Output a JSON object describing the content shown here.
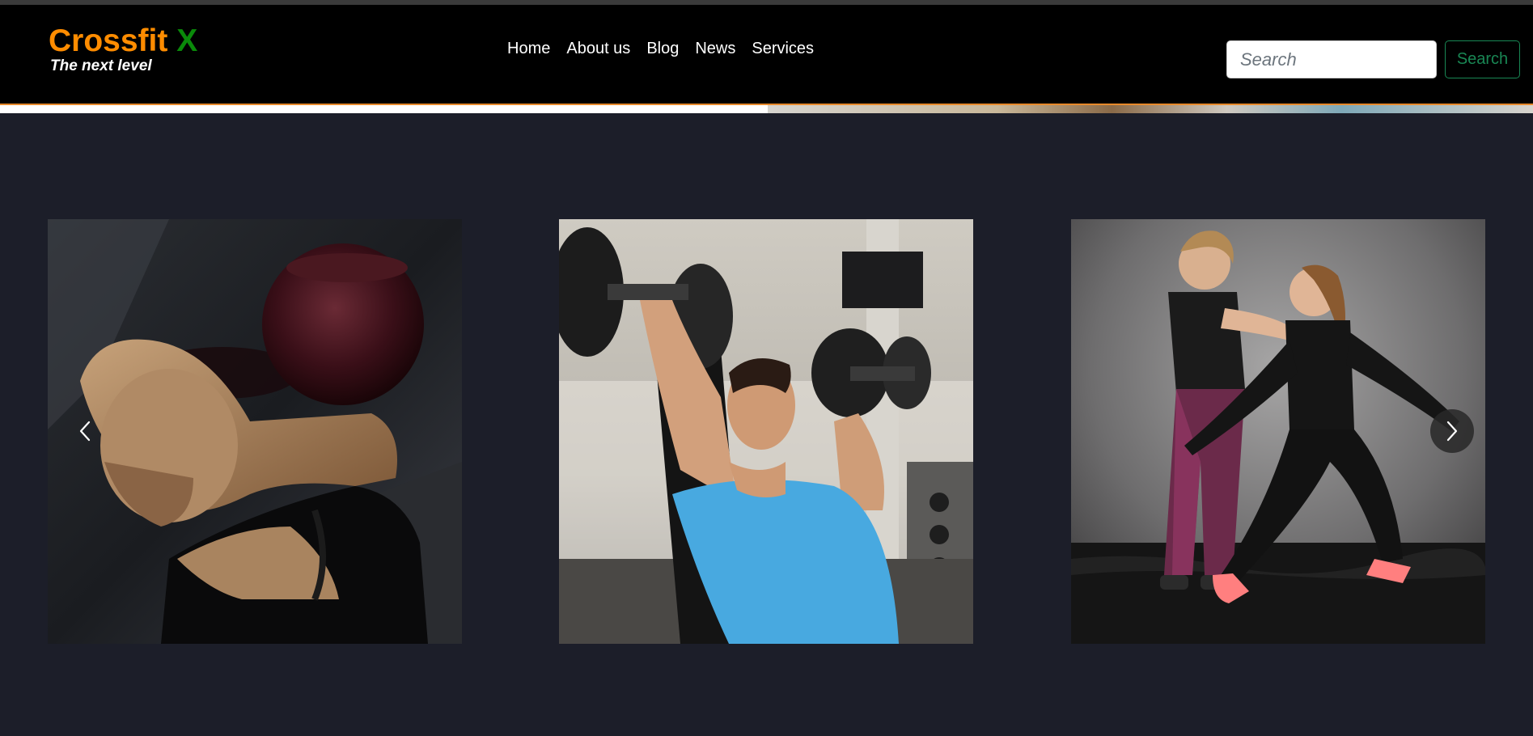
{
  "brand": {
    "name": "Crossfit",
    "accent": "X",
    "tagline": "The next level"
  },
  "nav": {
    "items": [
      "Home",
      "About us",
      "Blog",
      "News",
      "Services"
    ]
  },
  "search": {
    "placeholder": "Search",
    "button_label": "Search"
  },
  "colors": {
    "brand_orange": "#ff8c00",
    "brand_green": "#0a8a0a",
    "search_button": "#198754",
    "page_bg": "#1c1e29",
    "navbar_bg": "#000000"
  },
  "carousel": {
    "slides": [
      {
        "label": "man-with-kettlebell"
      },
      {
        "label": "woman-dumbbell-press"
      },
      {
        "label": "trainer-with-client"
      }
    ],
    "prev_icon": "chevron-left-icon",
    "next_icon": "chevron-right-icon"
  }
}
